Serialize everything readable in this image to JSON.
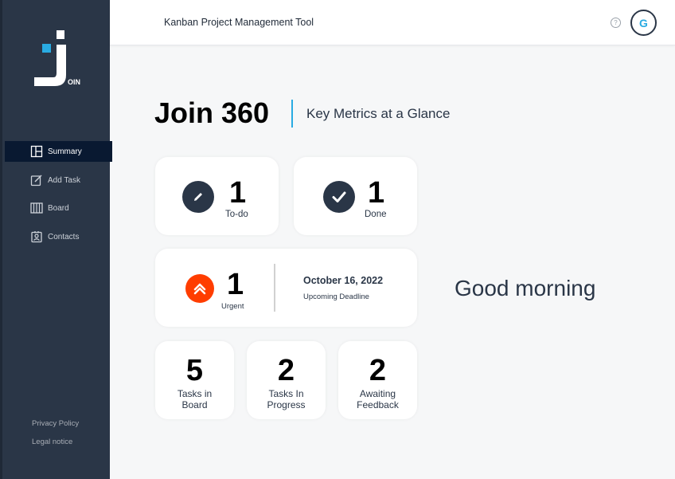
{
  "sidebar": {
    "logo_text": "OIN",
    "items": [
      {
        "label": "Summary",
        "icon": "summary-icon"
      },
      {
        "label": "Add Task",
        "icon": "add-task-icon"
      },
      {
        "label": "Board",
        "icon": "board-icon"
      },
      {
        "label": "Contacts",
        "icon": "contacts-icon"
      }
    ],
    "footer": {
      "privacy": "Privacy Policy",
      "legal": "Legal notice"
    }
  },
  "header": {
    "title": "Kanban Project Management Tool",
    "help": "?",
    "avatar_initial": "G"
  },
  "main": {
    "title": "Join 360",
    "subtitle": "Key Metrics at a Glance",
    "todo": {
      "count": "1",
      "label": "To-do"
    },
    "done": {
      "count": "1",
      "label": "Done"
    },
    "urgent": {
      "count": "1",
      "label": "Urgent",
      "deadline_date": "October 16, 2022",
      "deadline_label": "Upcoming Deadline"
    },
    "stats": [
      {
        "count": "5",
        "label_1": "Tasks in",
        "label_2": "Board"
      },
      {
        "count": "2",
        "label_1": "Tasks In",
        "label_2": "Progress"
      },
      {
        "count": "2",
        "label_1": "Awaiting",
        "label_2": "Feedback"
      }
    ],
    "greeting": "Good morning"
  },
  "colors": {
    "sidebar": "#2a3647",
    "active": "#091931",
    "accent": "#29abe2",
    "urgent": "#ff3d00"
  }
}
